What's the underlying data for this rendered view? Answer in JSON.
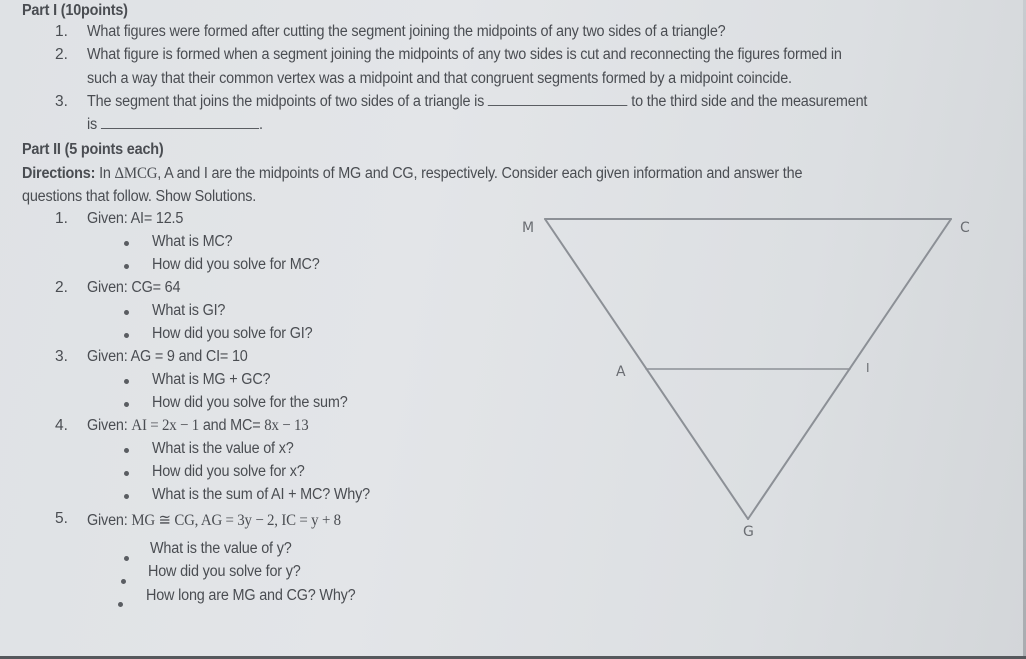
{
  "part1": {
    "heading": "Part I (10points)",
    "items": [
      {
        "num": "1.",
        "text": "What figures were formed after cutting the segment joining the midpoints of any two sides of a triangle?"
      },
      {
        "num": "2.",
        "text": "What figure is formed when a segment joining the midpoints of any two sides is cut and reconnecting the figures formed in",
        "text2": "such a way that their common vertex was a midpoint and that congruent segments formed by a midpoint coincide."
      },
      {
        "num": "3.",
        "text_a": "The segment that joins the midpoints of two sides of a triangle is",
        "text_b": "to the third side and the measurement",
        "text_c": "is",
        "text_d": "."
      }
    ]
  },
  "part2": {
    "heading": "Part II (5 points each)",
    "directions_label": "Directions:",
    "directions_a": " In ",
    "directions_tri": "ΔMCG",
    "directions_b": ", A and I are the midpoints of  MG and CG, respectively. Consider each given information and answer the",
    "directions_line2": "questions that follow.  Show Solutions.",
    "questions": [
      {
        "num": "1.",
        "given_label": "Given:",
        "given": "AI= 12.5",
        "bullets": [
          "What is MC?",
          "How did you solve for MC?"
        ]
      },
      {
        "num": "2.",
        "given_label": "Given:",
        "given": "CG= 64",
        "bullets": [
          "What is GI?",
          "How did you solve for GI?"
        ]
      },
      {
        "num": "3.",
        "given_label": "Given:",
        "given": "AG = 9 and CI= 10",
        "bullets": [
          "What is MG +  GC?",
          "How did you solve for the sum?"
        ]
      },
      {
        "num": "4.",
        "given_label": "Given:",
        "given_a": "AI = 2x − 1",
        "given_b": " and MC= ",
        "given_c": "8x −  13",
        "bullets": [
          "What is the value of x?",
          "How did you solve for x?",
          "What is the sum of AI + MC? Why?"
        ]
      },
      {
        "num": "5.",
        "given_label": "Given:",
        "given": "MG ≅ CG, AG = 3y − 2, IC = y + 8",
        "bullets": [
          "What is the value of y?",
          "How did you solve for y?",
          "How long are  MG and  CG? Why?"
        ]
      }
    ]
  },
  "figure": {
    "labels": {
      "M": "M",
      "C": "C",
      "A": "A",
      "I": "I",
      "G": "G"
    },
    "line_color": "#8c9096"
  }
}
